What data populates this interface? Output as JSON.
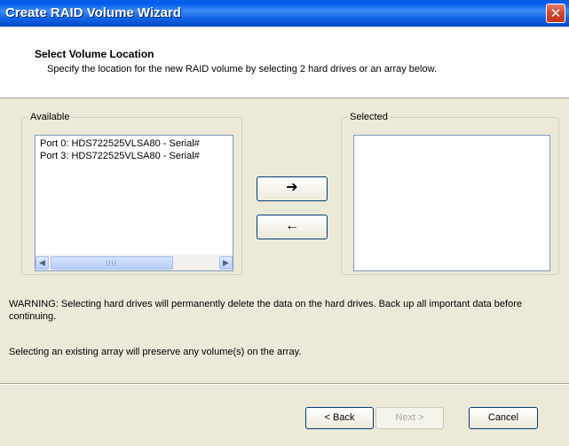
{
  "window": {
    "title": "Create RAID Volume Wizard",
    "close_icon": "close-icon"
  },
  "header": {
    "title": "Select Volume Location",
    "description": "Specify the location for the new RAID volume by selecting 2 hard drives or an array below."
  },
  "available": {
    "label": "Available",
    "items": [
      {
        "label": "Port 0: HDS722525VLSA80 - Serial#"
      },
      {
        "label": "Port 3: HDS722525VLSA80 - Serial#"
      }
    ],
    "scroll_grip": "III"
  },
  "selected": {
    "label": "Selected",
    "items": []
  },
  "buttons": {
    "add": "➔",
    "remove": "←",
    "back": "< Back",
    "next": "Next >",
    "cancel": "Cancel"
  },
  "messages": {
    "warning": "WARNING: Selecting hard drives will permanently delete the data on the hard drives. Back up all important data before continuing.",
    "preserve": "Selecting an existing array will preserve any volume(s) on the array."
  }
}
